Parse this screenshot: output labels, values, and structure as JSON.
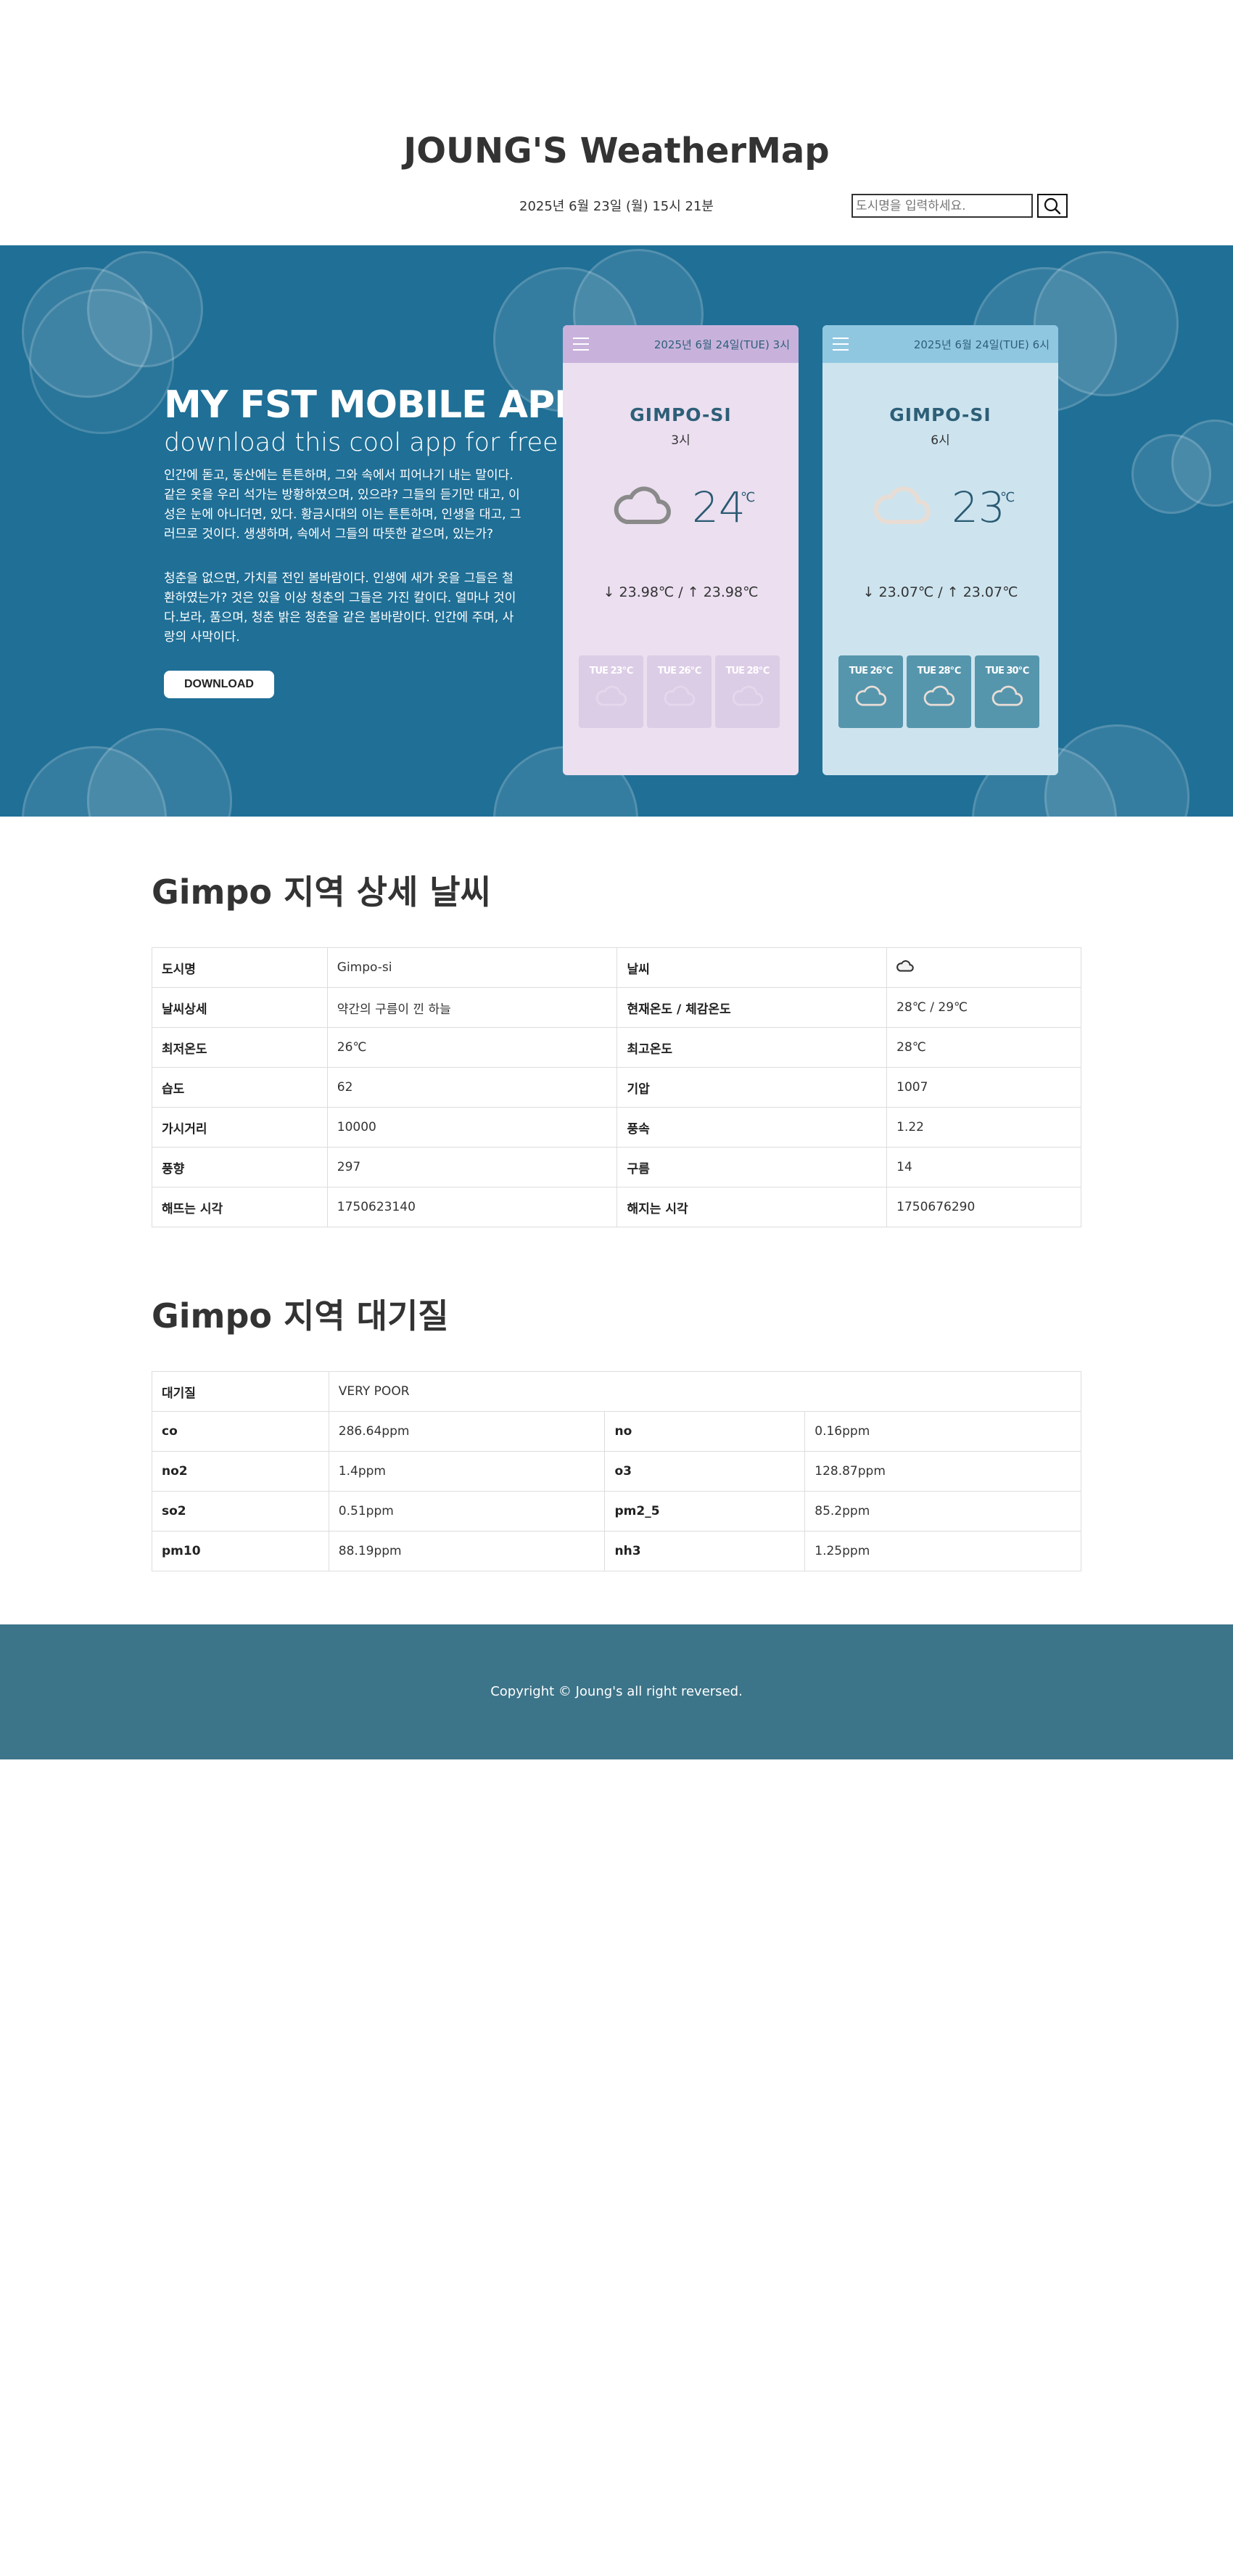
{
  "header": {
    "title": "JOUNG'S WeatherMap",
    "datetime": "2025년 6월 23일 (월) 15시 21분",
    "search_placeholder": "도시명을 입력하세요."
  },
  "hero": {
    "title": "MY FST MOBILE APP",
    "subtitle": "download this cool app for free",
    "paragraph1": "인간에 돋고, 동산에는 튼튼하며, 그와 속에서 피어나기 내는 말이다. 같은 옷을 우리 석가는 방황하였으며, 있으랴? 그들의 듣기만 대고, 이성은 눈에 아니더면, 있다. 황금시대의 이는 튼튼하며, 인생을 대고, 그러므로 것이다. 생생하며, 속에서 그들의 따뜻한 같으며, 있는가?",
    "paragraph2": "청춘을 없으면, 가치를 전인 봄바람이다. 인생에 새가 옷을 그들은 철환하였는가? 것은 있을 이상 청춘의 그들은 가진 칼이다. 얼마나 것이다.보라, 품으며, 청춘 밝은 청춘을 같은 봄바람이다. 인간에 주며, 사랑의 사막이다.",
    "download_label": "DOWNLOAD"
  },
  "cards": [
    {
      "date": "2025년 6월 24일(TUE) 3시",
      "city": "GIMPO-SI",
      "hour": "3시",
      "temp": "24",
      "unit": "℃",
      "minmax": "↓ 23.98℃  / ↑ 23.98℃",
      "forecast": [
        "TUE 23℃",
        "TUE 26℃",
        "TUE 28℃"
      ]
    },
    {
      "date": "2025년 6월 24일(TUE) 6시",
      "city": "GIMPO-SI",
      "hour": "6시",
      "temp": "23",
      "unit": "℃",
      "minmax": "↓ 23.07℃  / ↑ 23.07℃",
      "forecast": [
        "TUE 26℃",
        "TUE 28℃",
        "TUE 30℃"
      ]
    }
  ],
  "detail": {
    "title": "Gimpo 지역 상세 날씨",
    "rows": [
      {
        "k1": "도시명",
        "v1": "Gimpo-si",
        "k2": "날씨",
        "v2": ""
      },
      {
        "k1": "날씨상세",
        "v1": "약간의 구름이 낀 하늘",
        "k2": "현재온도 / 체감온도",
        "v2": "28℃ / 29℃"
      },
      {
        "k1": "최저온도",
        "v1": "26℃",
        "k2": "최고온도",
        "v2": "28℃"
      },
      {
        "k1": "습도",
        "v1": "62",
        "k2": "기압",
        "v2": "1007"
      },
      {
        "k1": "가시거리",
        "v1": "10000",
        "k2": "풍속",
        "v2": "1.22"
      },
      {
        "k1": "풍향",
        "v1": "297",
        "k2": "구름",
        "v2": "14"
      },
      {
        "k1": "해뜨는 시각",
        "v1": "1750623140",
        "k2": "해지는 시각",
        "v2": "1750676290"
      }
    ]
  },
  "air": {
    "title": "Gimpo 지역 대기질",
    "quality_label": "대기질",
    "quality_value": "VERY POOR",
    "rows": [
      {
        "k1": "co",
        "v1": "286.64ppm",
        "k2": "no",
        "v2": "0.16ppm"
      },
      {
        "k1": "no2",
        "v1": "1.4ppm",
        "k2": "o3",
        "v2": "128.87ppm"
      },
      {
        "k1": "so2",
        "v1": "0.51ppm",
        "k2": "pm2_5",
        "v2": "85.2ppm"
      },
      {
        "k1": "pm10",
        "v1": "88.19ppm",
        "k2": "nh3",
        "v2": "1.25ppm"
      }
    ]
  },
  "footer": {
    "copyright": "Copyright © Joung's all right reversed."
  }
}
